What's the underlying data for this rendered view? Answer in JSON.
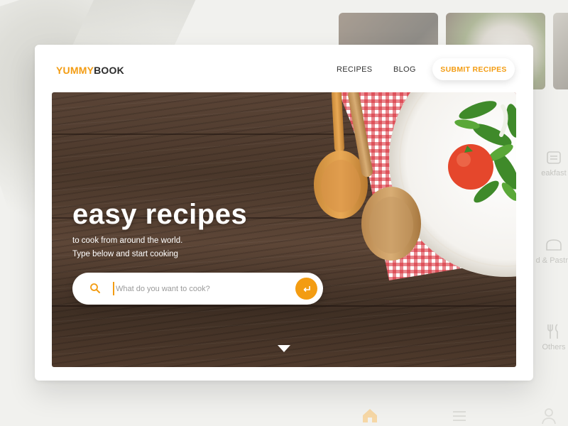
{
  "brand": {
    "part1": "YUMMY",
    "part2": "BOOK"
  },
  "nav": {
    "recipes": "RECIPES",
    "blog": "BLOG",
    "submit": "SUBMIT RECIPES"
  },
  "hero": {
    "title": "easy recipes",
    "subtitle_line1": "to cook from around the world.",
    "subtitle_line2": "Type below and start cooking"
  },
  "search": {
    "placeholder": "What do you want to cook?",
    "value": "",
    "icons": {
      "search": "search-icon",
      "submit": "enter-arrow-icon"
    }
  },
  "background": {
    "side_categories": [
      "eakfast",
      "d & Pastry",
      "Others"
    ]
  },
  "colors": {
    "accent": "#f39c12",
    "dark_text": "#2b2b2b",
    "wood": "#4b382b"
  }
}
